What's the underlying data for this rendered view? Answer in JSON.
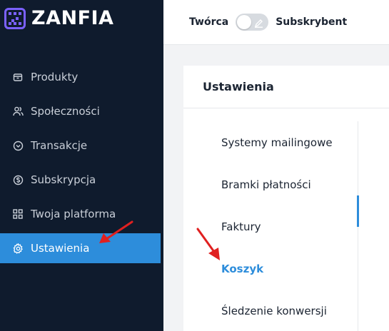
{
  "brand": {
    "name": "ZANFIA",
    "accent": "#7b61ff"
  },
  "sidebar": {
    "items": [
      {
        "label": "Produkty",
        "icon": "box-icon"
      },
      {
        "label": "Społeczności",
        "icon": "users-icon"
      },
      {
        "label": "Transakcje",
        "icon": "transactions-icon"
      },
      {
        "label": "Subskrypcja",
        "icon": "dollar-circle-icon"
      },
      {
        "label": "Twoja platforma",
        "icon": "grid-icon"
      },
      {
        "label": "Ustawienia",
        "icon": "gear-icon",
        "active": true
      }
    ],
    "active_color": "#2d8ddb",
    "background": "#0f1b2d"
  },
  "topbar": {
    "left_label": "Twórca",
    "right_label": "Subskrybent",
    "toggle_icon": "pencil-icon"
  },
  "settings": {
    "title": "Ustawienia",
    "subnav": [
      {
        "label": "Systemy mailingowe"
      },
      {
        "label": "Bramki płatności"
      },
      {
        "label": "Faktury"
      },
      {
        "label": "Koszyk",
        "active": true
      },
      {
        "label": "Śledzenie konwersji"
      }
    ]
  },
  "annotations": {
    "arrow_color": "#e02020"
  }
}
